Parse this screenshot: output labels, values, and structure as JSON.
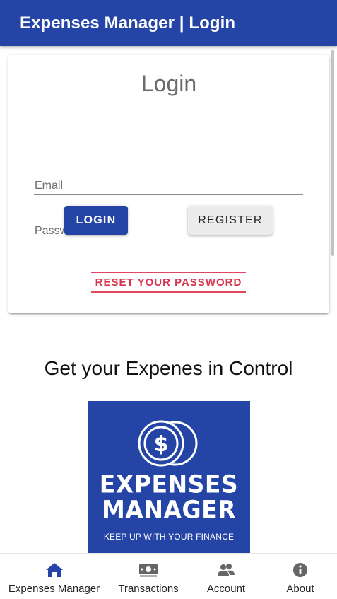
{
  "app_bar": {
    "title": "Expenses Manager | Login"
  },
  "login_card": {
    "title": "Login",
    "email_placeholder": "Email",
    "email_value": "",
    "password_placeholder": "Password",
    "password_value": "",
    "login_label": "LOGIN",
    "register_label": "REGISTER",
    "reset_label": "RESET YOUR PASSWORD"
  },
  "tagline": "Get your Expenes in Control",
  "logo": {
    "line1": "EXPENSES",
    "line2": "MANAGER",
    "subtitle": "KEEP UP WITH YOUR FINANCE",
    "icon": "dollar-coins-icon"
  },
  "bottom_nav": {
    "items": [
      {
        "label": "Expenses Manager",
        "icon": "home-icon"
      },
      {
        "label": "Transactions",
        "icon": "money-icon"
      },
      {
        "label": "Account",
        "icon": "people-icon"
      },
      {
        "label": "About",
        "icon": "info-icon"
      }
    ]
  },
  "colors": {
    "primary": "#2445a5",
    "accent_red": "#d6334d",
    "nav_active": "#2445a5",
    "nav_inactive": "#666666"
  }
}
